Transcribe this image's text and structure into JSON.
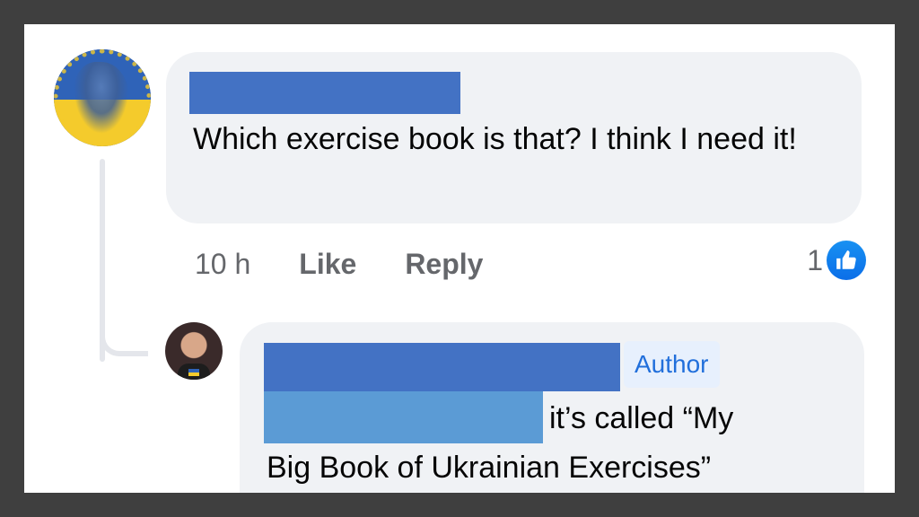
{
  "comment": {
    "text": "Which exercise book is that?  I think I need it!",
    "time": "10 h",
    "like_label": "Like",
    "reply_label": "Reply",
    "reaction_count": "1",
    "reaction_icon": "thumbs-up-icon",
    "reaction_color": "#1877f2"
  },
  "reply": {
    "author_badge": "Author",
    "line_1": "it’s called “My",
    "line_2": "Big Book of Ukrainian Exercises”"
  },
  "colors": {
    "redaction_name": "#4372c4",
    "redaction_mention": "#5b9bd5",
    "bubble": "#f0f2f5",
    "author_badge_text": "#216fdb"
  }
}
